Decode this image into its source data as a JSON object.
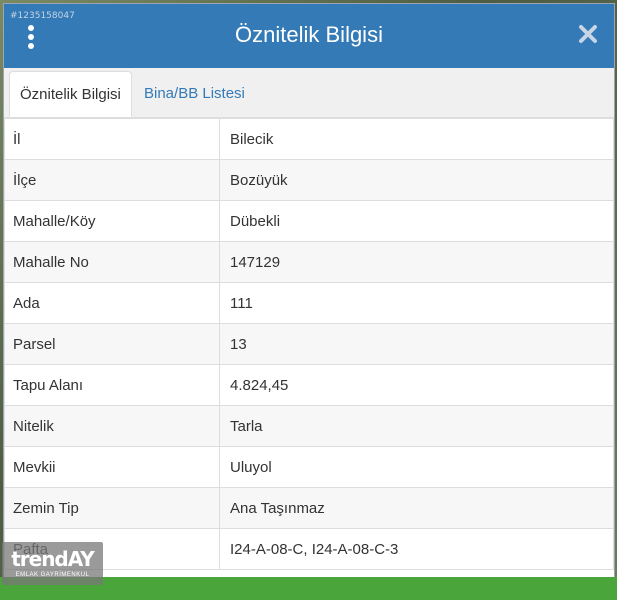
{
  "watermark_id": "#1235158047",
  "header": {
    "title": "Öznitelik Bilgisi",
    "menu_icon": "kebab-menu-icon",
    "close_icon": "close-icon"
  },
  "tabs": [
    {
      "label": "Öznitelik Bilgisi",
      "active": true
    },
    {
      "label": "Bina/BB Listesi",
      "active": false
    }
  ],
  "rows": [
    {
      "key": "İl",
      "value": "Bilecik"
    },
    {
      "key": "İlçe",
      "value": "Bozüyük"
    },
    {
      "key": "Mahalle/Köy",
      "value": "Dübekli"
    },
    {
      "key": "Mahalle No",
      "value": "147129"
    },
    {
      "key": "Ada",
      "value": "111"
    },
    {
      "key": "Parsel",
      "value": "13"
    },
    {
      "key": "Tapu Alanı",
      "value": "4.824,45"
    },
    {
      "key": "Nitelik",
      "value": "Tarla"
    },
    {
      "key": "Mevkii",
      "value": "Uluyol"
    },
    {
      "key": "Zemin Tip",
      "value": "Ana Taşınmaz"
    },
    {
      "key": "Pafta",
      "value": "I24-A-08-C, I24-A-08-C-3"
    }
  ],
  "logo": {
    "main": "trendAY",
    "sub": "EMLAK GAYRİMENKUL"
  },
  "colors": {
    "header": "#337ab7",
    "tab_link": "#337ab7",
    "bottom_bar": "#4aa53b"
  }
}
